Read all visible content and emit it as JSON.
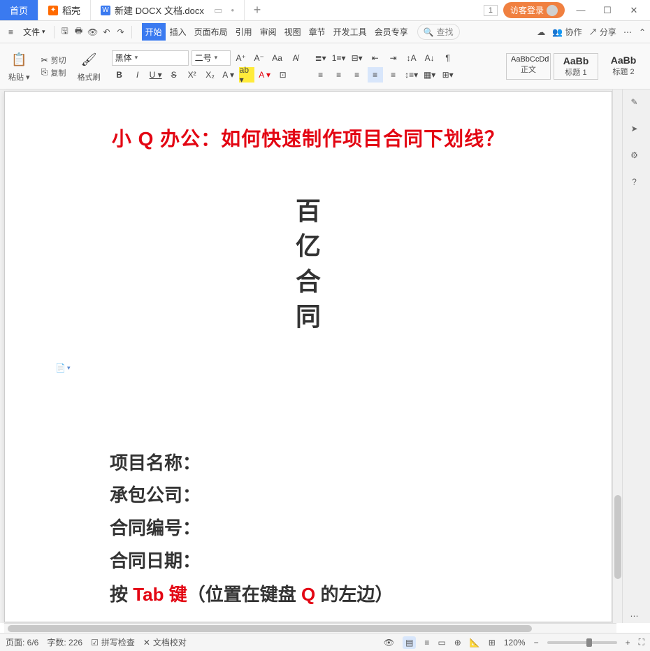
{
  "tabs": {
    "home": "首页",
    "shell": "稻壳",
    "doc": "新建 DOCX 文档.docx"
  },
  "titlebar": {
    "page_indicator": "1",
    "login": "访客登录"
  },
  "menu": {
    "file": "文件",
    "ribbon": [
      "开始",
      "插入",
      "页面布局",
      "引用",
      "审阅",
      "视图",
      "章节",
      "开发工具",
      "会员专享"
    ],
    "search": "查找",
    "collab": "协作",
    "share": "分享"
  },
  "toolbar": {
    "paste": "粘贴",
    "cut": "剪切",
    "copy": "复制",
    "format_painter": "格式刷",
    "font_family": "黑体",
    "font_size": "二号",
    "styles": [
      {
        "sample": "AaBbCcDd",
        "name": "正文"
      },
      {
        "sample": "AaBb",
        "name": "标题 1"
      },
      {
        "sample": "AaBb",
        "name": "标题 2"
      }
    ]
  },
  "document": {
    "title_red": "小 Q 办公：如何快速制作项目合同下划线？",
    "vertical": [
      "百",
      "亿",
      "合",
      "同"
    ],
    "fields": [
      "项目名称：",
      "承包公司：",
      "合同编号：",
      "合同日期："
    ],
    "last_prefix": "按 ",
    "last_red1": "Tab 键",
    "last_mid": "（位置在键盘 ",
    "last_red2": "Q",
    "last_suffix": " 的左边）"
  },
  "status": {
    "page": "页面: 6/6",
    "words": "字数: 226",
    "spell": "拼写检查",
    "proof": "文档校对",
    "zoom": "120%"
  }
}
